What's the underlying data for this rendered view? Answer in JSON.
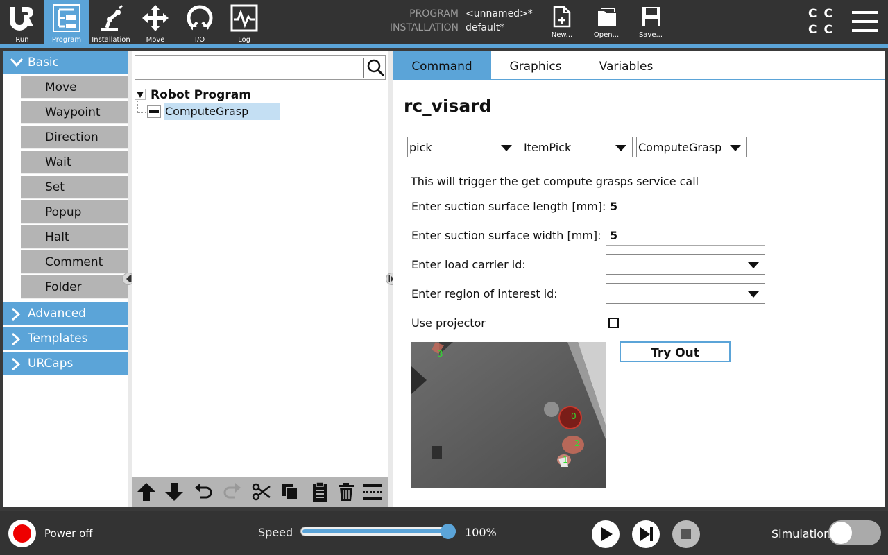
{
  "nav": {
    "run": "Run",
    "program": "Program",
    "installation": "Installation",
    "move": "Move",
    "io": "I/O",
    "log": "Log",
    "active": "program"
  },
  "program_info": {
    "program_key": "PROGRAM",
    "program_value": "<unnamed>*",
    "installation_key": "INSTALLATION",
    "installation_value": "default*"
  },
  "file_menu": {
    "new": "New...",
    "open": "Open...",
    "save": "Save..."
  },
  "status_letters": {
    "row1": "CC",
    "row2": "CC"
  },
  "palette": {
    "basic": "Basic",
    "items": [
      "Move",
      "Waypoint",
      "Direction",
      "Wait",
      "Set",
      "Popup",
      "Halt",
      "Comment",
      "Folder"
    ],
    "advanced": "Advanced",
    "templates": "Templates",
    "urcaps": "URCaps"
  },
  "search": {
    "value": "",
    "placeholder": ""
  },
  "tree": {
    "root": "Robot Program",
    "child": "ComputeGrasp"
  },
  "tabs": [
    "Command",
    "Graphics",
    "Variables"
  ],
  "active_tab": "Command",
  "node": {
    "title": "rc_visard",
    "select_1": "pick",
    "select_2": "ItemPick",
    "select_3": "ComputeGrasp",
    "description": "This will trigger the get compute grasps service call",
    "length_label": "Enter suction surface length [mm]:",
    "length_value": "5",
    "width_label": "Enter suction surface width [mm]:",
    "width_value": "5",
    "load_carrier_label": "Enter load carrier id:",
    "load_carrier_value": "",
    "roi_label": "Enter region of interest id:",
    "roi_value": "",
    "projector_label": "Use projector",
    "projector_checked": false,
    "try_out": "Try Out",
    "grasp_labels": [
      "0",
      "1",
      "2",
      "3"
    ]
  },
  "bottom": {
    "power": "Power off",
    "speed_label": "Speed",
    "speed_value": "100%",
    "speed_fraction": 1.0,
    "simulation": "Simulation",
    "simulation_on": false
  },
  "colors": {
    "accent": "#5ba4d8",
    "power": "#e00000",
    "bar": "#333333"
  }
}
